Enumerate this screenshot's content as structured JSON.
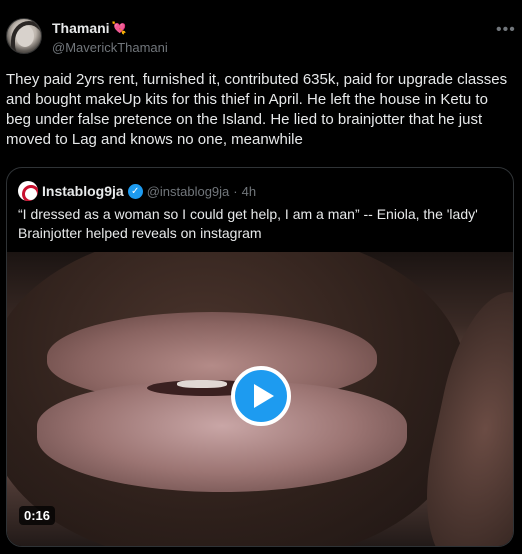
{
  "author": {
    "display_name": "Thamani",
    "name_emoji": "💘",
    "handle": "@MaverickThamani"
  },
  "tweet": {
    "text": "They paid 2yrs rent, furnished it, contributed 635k, paid for upgrade classes and bought makeUp kits for this thief in April. He left the house in Ketu to beg under false pretence on the Island. He lied to brainjotter that he just moved to Lag and knows no one, meanwhile"
  },
  "quoted": {
    "display_name": "Instablog9ja",
    "handle": "@instablog9ja",
    "separator": "·",
    "time": "4h",
    "text": "“I dressed as a woman so I could get help, I am a man” -- Eniola, the 'lady' Brainjotter helped reveals on instagram",
    "video_duration": "0:16"
  },
  "icons": {
    "more": "more-horizontal-icon",
    "verified": "verified-badge-icon",
    "play": "play-icon"
  },
  "colors": {
    "background": "#000000",
    "accent": "#1d9bf0",
    "secondary_text": "#71767b"
  }
}
